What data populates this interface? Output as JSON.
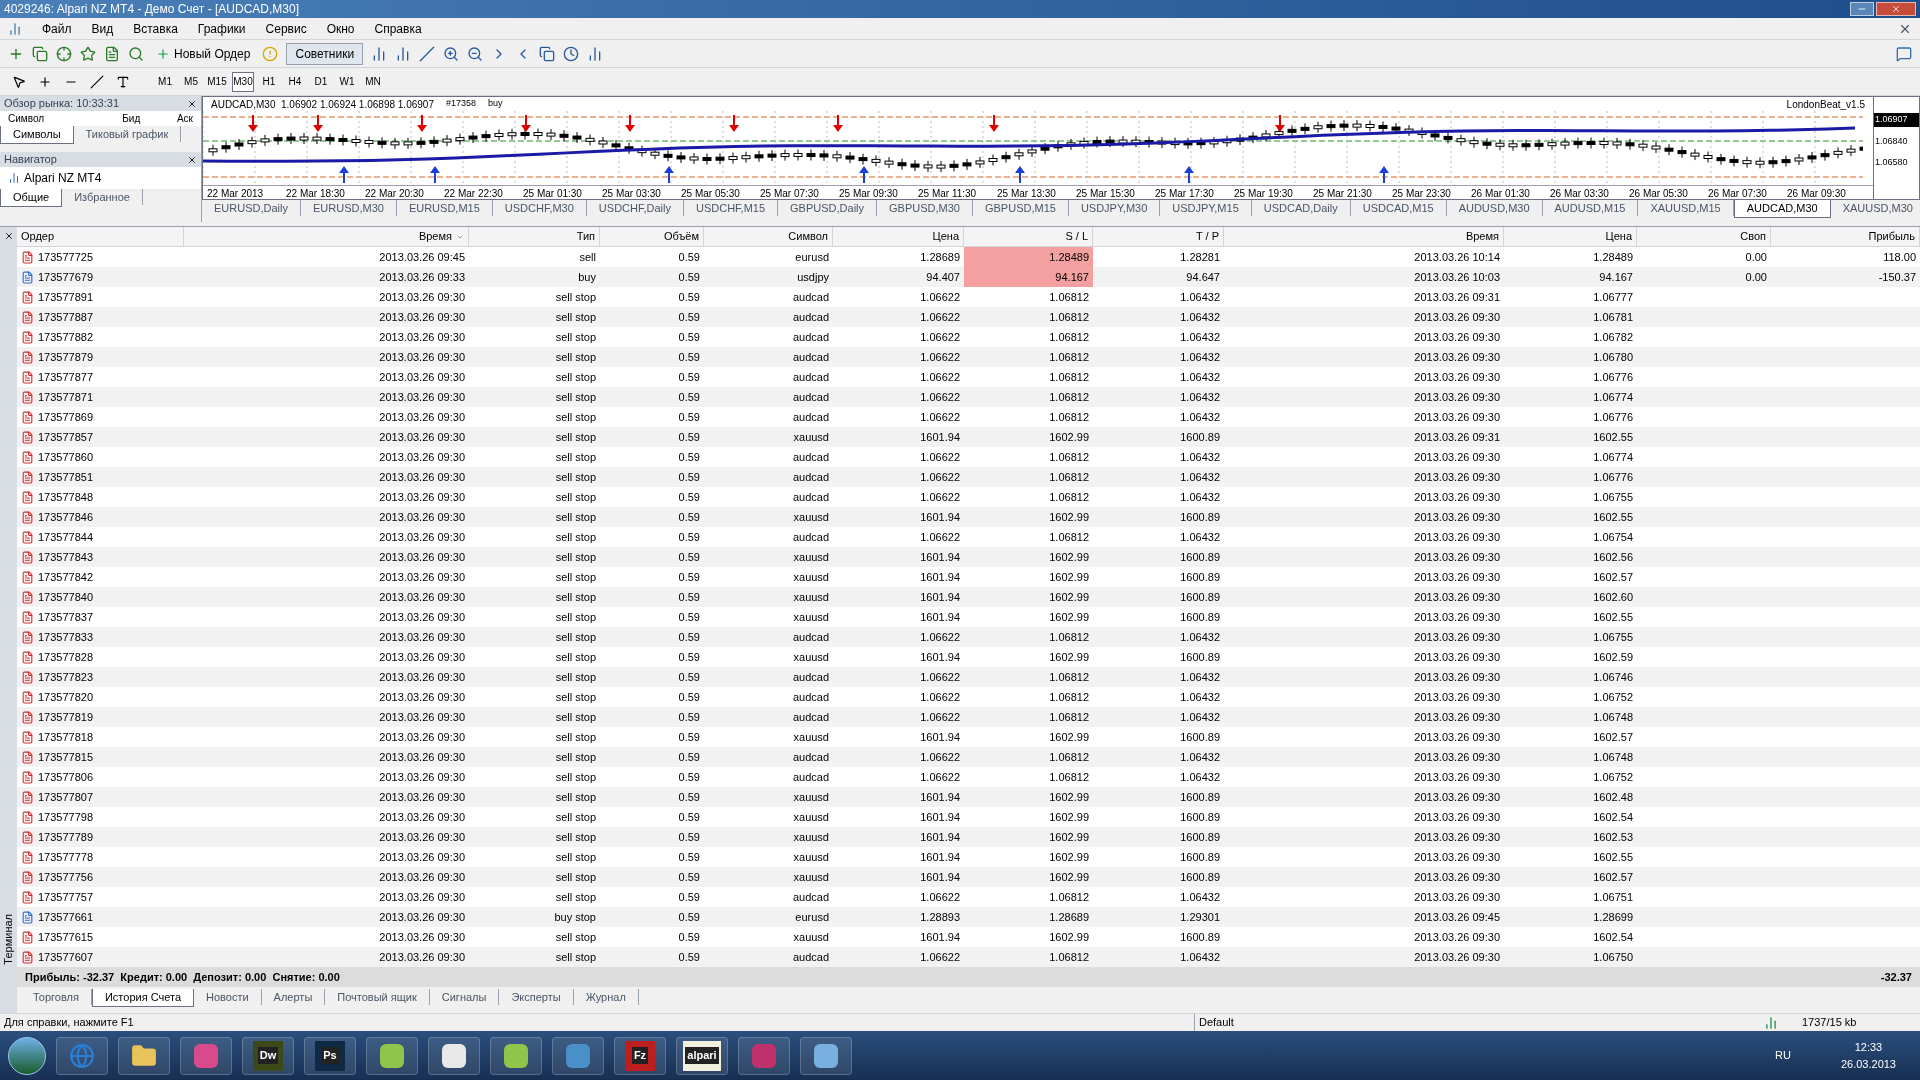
{
  "window": {
    "title": "4029246: Alpari NZ MT4 - Демо Счет - [AUDCAD,M30]"
  },
  "menu": [
    "Файл",
    "Вид",
    "Вставка",
    "Графики",
    "Сервис",
    "Окно",
    "Справка"
  ],
  "toolbar": {
    "buttons": [
      {
        "label": "Новый Ордер"
      },
      {
        "label": "Советники"
      }
    ],
    "timeframes": [
      {
        "label": "M1",
        "selected": false
      },
      {
        "label": "M5",
        "selected": false
      },
      {
        "label": "M15",
        "selected": false
      },
      {
        "label": "M30",
        "selected": true
      },
      {
        "label": "H1",
        "selected": false
      },
      {
        "label": "H4",
        "selected": false
      },
      {
        "label": "D1",
        "selected": false
      },
      {
        "label": "W1",
        "selected": false
      },
      {
        "label": "MN",
        "selected": false
      }
    ]
  },
  "market_watch": {
    "title": "Обзор рынка: 10:33:31",
    "columns": [
      "Символ",
      "Бид",
      "Аск"
    ],
    "tabs": [
      {
        "label": "Символы",
        "selected": true
      },
      {
        "label": "Тиковый график",
        "selected": false
      }
    ]
  },
  "navigator": {
    "title": "Навигатор",
    "tree": [
      {
        "label": "Alpari NZ MT4"
      }
    ],
    "tabs": [
      {
        "label": "Общие",
        "selected": true
      },
      {
        "label": "Избранное",
        "selected": false
      }
    ]
  },
  "chart": {
    "header": "AUDCAD,M30  1.06902 1.06924 1.06898 1.06907",
    "order_label": "#17358",
    "order_type": "buy",
    "indicator": "LondonBeat_v1.5",
    "price_labels": [
      {
        "text": "1.06907",
        "kind": "current"
      },
      {
        "text": "1.06840",
        "kind": "level"
      },
      {
        "text": "1.06580",
        "kind": "level"
      }
    ],
    "time_labels": [
      "22 Mar 2013",
      "22 Mar 18:30",
      "22 Mar 20:30",
      "22 Mar 22:30",
      "25 Mar 01:30",
      "25 Mar 03:30",
      "25 Mar 05:30",
      "25 Mar 07:30",
      "25 Mar 09:30",
      "25 Mar 11:30",
      "25 Mar 13:30",
      "25 Mar 15:30",
      "25 Mar 17:30",
      "25 Mar 19:30",
      "25 Mar 21:30",
      "25 Mar 23:30",
      "26 Mar 01:30",
      "26 Mar 03:30",
      "26 Mar 05:30",
      "26 Mar 07:30",
      "26 Mar 09:30"
    ]
  },
  "chart_tabs": [
    {
      "label": "EURUSD,Daily",
      "selected": false
    },
    {
      "label": "EURUSD,M30",
      "selected": false
    },
    {
      "label": "EURUSD,M15",
      "selected": false
    },
    {
      "label": "USDCHF,M30",
      "selected": false
    },
    {
      "label": "USDCHF,Daily",
      "selected": false
    },
    {
      "label": "USDCHF,M15",
      "selected": false
    },
    {
      "label": "GBPUSD,Daily",
      "selected": false
    },
    {
      "label": "GBPUSD,M30",
      "selected": false
    },
    {
      "label": "GBPUSD,M15",
      "selected": false
    },
    {
      "label": "USDJPY,M30",
      "selected": false
    },
    {
      "label": "USDJPY,M15",
      "selected": false
    },
    {
      "label": "USDCAD,Daily",
      "selected": false
    },
    {
      "label": "USDCAD,M15",
      "selected": false
    },
    {
      "label": "AUDUSD,M30",
      "selected": false
    },
    {
      "label": "AUDUSD,M15",
      "selected": false
    },
    {
      "label": "XAUUSD,M15",
      "selected": false
    },
    {
      "label": "AUDCAD,M30",
      "selected": true
    },
    {
      "label": "XAUUSD,M30",
      "selected": false
    }
  ],
  "terminal": {
    "title": "Терминал",
    "columns": [
      "Ордер",
      "Время",
      "Тип",
      "Объём",
      "Символ",
      "Цена",
      "S / L",
      "T / P",
      "Время",
      "Цена",
      "Своп",
      "Прибыль"
    ],
    "rows": [
      {
        "kind": "sell",
        "sl_highlighted": true,
        "cells": [
          "173577725",
          "2013.03.26 09:45",
          "sell",
          "0.59",
          "eurusd",
          "1.28689",
          "1.28489",
          "1.28281",
          "2013.03.26 10:14",
          "1.28489",
          "0.00",
          "118.00"
        ]
      },
      {
        "kind": "buy",
        "sl_highlighted": true,
        "cells": [
          "173577679",
          "2013.03.26 09:33",
          "buy",
          "0.59",
          "usdjpy",
          "94.407",
          "94.167",
          "94.647",
          "2013.03.26 10:03",
          "94.167",
          "0.00",
          "-150.37"
        ]
      },
      {
        "kind": "sell",
        "sl_highlighted": false,
        "cells": [
          "173577891",
          "2013.03.26 09:30",
          "sell stop",
          "0.59",
          "audcad",
          "1.06622",
          "1.06812",
          "1.06432",
          "2013.03.26 09:31",
          "1.06777"
        ]
      },
      {
        "kind": "sell",
        "sl_highlighted": false,
        "cells": [
          "173577887",
          "2013.03.26 09:30",
          "sell stop",
          "0.59",
          "audcad",
          "1.06622",
          "1.06812",
          "1.06432",
          "2013.03.26 09:30",
          "1.06781"
        ]
      },
      {
        "kind": "sell",
        "sl_highlighted": false,
        "cells": [
          "173577882",
          "2013.03.26 09:30",
          "sell stop",
          "0.59",
          "audcad",
          "1.06622",
          "1.06812",
          "1.06432",
          "2013.03.26 09:30",
          "1.06782"
        ]
      },
      {
        "kind": "sell",
        "sl_highlighted": false,
        "cells": [
          "173577879",
          "2013.03.26 09:30",
          "sell stop",
          "0.59",
          "audcad",
          "1.06622",
          "1.06812",
          "1.06432",
          "2013.03.26 09:30",
          "1.06780"
        ]
      },
      {
        "kind": "sell",
        "sl_highlighted": false,
        "cells": [
          "173577877",
          "2013.03.26 09:30",
          "sell stop",
          "0.59",
          "audcad",
          "1.06622",
          "1.06812",
          "1.06432",
          "2013.03.26 09:30",
          "1.06776"
        ]
      },
      {
        "kind": "sell",
        "sl_highlighted": false,
        "cells": [
          "173577871",
          "2013.03.26 09:30",
          "sell stop",
          "0.59",
          "audcad",
          "1.06622",
          "1.06812",
          "1.06432",
          "2013.03.26 09:30",
          "1.06774"
        ]
      },
      {
        "kind": "sell",
        "sl_highlighted": false,
        "cells": [
          "173577869",
          "2013.03.26 09:30",
          "sell stop",
          "0.59",
          "audcad",
          "1.06622",
          "1.06812",
          "1.06432",
          "2013.03.26 09:30",
          "1.06776"
        ]
      },
      {
        "kind": "sell",
        "sl_highlighted": false,
        "cells": [
          "173577857",
          "2013.03.26 09:30",
          "sell stop",
          "0.59",
          "xauusd",
          "1601.94",
          "1602.99",
          "1600.89",
          "2013.03.26 09:31",
          "1602.55"
        ]
      },
      {
        "kind": "sell",
        "sl_highlighted": false,
        "cells": [
          "173577860",
          "2013.03.26 09:30",
          "sell stop",
          "0.59",
          "audcad",
          "1.06622",
          "1.06812",
          "1.06432",
          "2013.03.26 09:30",
          "1.06774"
        ]
      },
      {
        "kind": "sell",
        "sl_highlighted": false,
        "cells": [
          "173577851",
          "2013.03.26 09:30",
          "sell stop",
          "0.59",
          "audcad",
          "1.06622",
          "1.06812",
          "1.06432",
          "2013.03.26 09:30",
          "1.06776"
        ]
      },
      {
        "kind": "sell",
        "sl_highlighted": false,
        "cells": [
          "173577848",
          "2013.03.26 09:30",
          "sell stop",
          "0.59",
          "audcad",
          "1.06622",
          "1.06812",
          "1.06432",
          "2013.03.26 09:30",
          "1.06755"
        ]
      },
      {
        "kind": "sell",
        "sl_highlighted": false,
        "cells": [
          "173577846",
          "2013.03.26 09:30",
          "sell stop",
          "0.59",
          "xauusd",
          "1601.94",
          "1602.99",
          "1600.89",
          "2013.03.26 09:30",
          "1602.55"
        ]
      },
      {
        "kind": "sell",
        "sl_highlighted": false,
        "cells": [
          "173577844",
          "2013.03.26 09:30",
          "sell stop",
          "0.59",
          "audcad",
          "1.06622",
          "1.06812",
          "1.06432",
          "2013.03.26 09:30",
          "1.06754"
        ]
      },
      {
        "kind": "sell",
        "sl_highlighted": false,
        "cells": [
          "173577843",
          "2013.03.26 09:30",
          "sell stop",
          "0.59",
          "xauusd",
          "1601.94",
          "1602.99",
          "1600.89",
          "2013.03.26 09:30",
          "1602.56"
        ]
      },
      {
        "kind": "sell",
        "sl_highlighted": false,
        "cells": [
          "173577842",
          "2013.03.26 09:30",
          "sell stop",
          "0.59",
          "xauusd",
          "1601.94",
          "1602.99",
          "1600.89",
          "2013.03.26 09:30",
          "1602.57"
        ]
      },
      {
        "kind": "sell",
        "sl_highlighted": false,
        "cells": [
          "173577840",
          "2013.03.26 09:30",
          "sell stop",
          "0.59",
          "xauusd",
          "1601.94",
          "1602.99",
          "1600.89",
          "2013.03.26 09:30",
          "1602.60"
        ]
      },
      {
        "kind": "sell",
        "sl_highlighted": false,
        "cells": [
          "173577837",
          "2013.03.26 09:30",
          "sell stop",
          "0.59",
          "xauusd",
          "1601.94",
          "1602.99",
          "1600.89",
          "2013.03.26 09:30",
          "1602.55"
        ]
      },
      {
        "kind": "sell",
        "sl_highlighted": false,
        "cells": [
          "173577833",
          "2013.03.26 09:30",
          "sell stop",
          "0.59",
          "audcad",
          "1.06622",
          "1.06812",
          "1.06432",
          "2013.03.26 09:30",
          "1.06755"
        ]
      },
      {
        "kind": "sell",
        "sl_highlighted": false,
        "cells": [
          "173577828",
          "2013.03.26 09:30",
          "sell stop",
          "0.59",
          "xauusd",
          "1601.94",
          "1602.99",
          "1600.89",
          "2013.03.26 09:30",
          "1602.59"
        ]
      },
      {
        "kind": "sell",
        "sl_highlighted": false,
        "cells": [
          "173577823",
          "2013.03.26 09:30",
          "sell stop",
          "0.59",
          "audcad",
          "1.06622",
          "1.06812",
          "1.06432",
          "2013.03.26 09:30",
          "1.06746"
        ]
      },
      {
        "kind": "sell",
        "sl_highlighted": false,
        "cells": [
          "173577820",
          "2013.03.26 09:30",
          "sell stop",
          "0.59",
          "audcad",
          "1.06622",
          "1.06812",
          "1.06432",
          "2013.03.26 09:30",
          "1.06752"
        ]
      },
      {
        "kind": "sell",
        "sl_highlighted": false,
        "cells": [
          "173577819",
          "2013.03.26 09:30",
          "sell stop",
          "0.59",
          "audcad",
          "1.06622",
          "1.06812",
          "1.06432",
          "2013.03.26 09:30",
          "1.06748"
        ]
      },
      {
        "kind": "sell",
        "sl_highlighted": false,
        "cells": [
          "173577818",
          "2013.03.26 09:30",
          "sell stop",
          "0.59",
          "xauusd",
          "1601.94",
          "1602.99",
          "1600.89",
          "2013.03.26 09:30",
          "1602.57"
        ]
      },
      {
        "kind": "sell",
        "sl_highlighted": false,
        "cells": [
          "173577815",
          "2013.03.26 09:30",
          "sell stop",
          "0.59",
          "audcad",
          "1.06622",
          "1.06812",
          "1.06432",
          "2013.03.26 09:30",
          "1.06748"
        ]
      },
      {
        "kind": "sell",
        "sl_highlighted": false,
        "cells": [
          "173577806",
          "2013.03.26 09:30",
          "sell stop",
          "0.59",
          "audcad",
          "1.06622",
          "1.06812",
          "1.06432",
          "2013.03.26 09:30",
          "1.06752"
        ]
      },
      {
        "kind": "sell",
        "sl_highlighted": false,
        "cells": [
          "173577807",
          "2013.03.26 09:30",
          "sell stop",
          "0.59",
          "xauusd",
          "1601.94",
          "1602.99",
          "1600.89",
          "2013.03.26 09:30",
          "1602.48"
        ]
      },
      {
        "kind": "sell",
        "sl_highlighted": false,
        "cells": [
          "173577798",
          "2013.03.26 09:30",
          "sell stop",
          "0.59",
          "xauusd",
          "1601.94",
          "1602.99",
          "1600.89",
          "2013.03.26 09:30",
          "1602.54"
        ]
      },
      {
        "kind": "sell",
        "sl_highlighted": false,
        "cells": [
          "173577789",
          "2013.03.26 09:30",
          "sell stop",
          "0.59",
          "xauusd",
          "1601.94",
          "1602.99",
          "1600.89",
          "2013.03.26 09:30",
          "1602.53"
        ]
      },
      {
        "kind": "sell",
        "sl_highlighted": false,
        "cells": [
          "173577778",
          "2013.03.26 09:30",
          "sell stop",
          "0.59",
          "xauusd",
          "1601.94",
          "1602.99",
          "1600.89",
          "2013.03.26 09:30",
          "1602.55"
        ]
      },
      {
        "kind": "sell",
        "sl_highlighted": false,
        "cells": [
          "173577756",
          "2013.03.26 09:30",
          "sell stop",
          "0.59",
          "xauusd",
          "1601.94",
          "1602.99",
          "1600.89",
          "2013.03.26 09:30",
          "1602.57"
        ]
      },
      {
        "kind": "sell",
        "sl_highlighted": false,
        "cells": [
          "173577757",
          "2013.03.26 09:30",
          "sell stop",
          "0.59",
          "audcad",
          "1.06622",
          "1.06812",
          "1.06432",
          "2013.03.26 09:30",
          "1.06751"
        ]
      },
      {
        "kind": "buy",
        "sl_highlighted": false,
        "cells": [
          "173577661",
          "2013.03.26 09:30",
          "buy stop",
          "0.59",
          "eurusd",
          "1.28893",
          "1.28689",
          "1.29301",
          "2013.03.26 09:45",
          "1.28699"
        ]
      },
      {
        "kind": "sell",
        "sl_highlighted": false,
        "cells": [
          "173577615",
          "2013.03.26 09:30",
          "sell stop",
          "0.59",
          "xauusd",
          "1601.94",
          "1602.99",
          "1600.89",
          "2013.03.26 09:30",
          "1602.54"
        ]
      },
      {
        "kind": "sell",
        "sl_highlighted": false,
        "cells": [
          "173577607",
          "2013.03.26 09:30",
          "sell stop",
          "0.59",
          "audcad",
          "1.06622",
          "1.06812",
          "1.06432",
          "2013.03.26 09:30",
          "1.06750"
        ]
      }
    ],
    "summary": "Прибыль: -32.37  Кредит: 0.00  Депозит: 0.00  Снятие: 0.00",
    "total": "-32.37",
    "tabs": [
      {
        "label": "Торговля",
        "selected": false
      },
      {
        "label": "История Счета",
        "selected": true
      },
      {
        "label": "Новости",
        "selected": false
      },
      {
        "label": "Алерты",
        "selected": false
      },
      {
        "label": "Почтовый ящик",
        "selected": false
      },
      {
        "label": "Сигналы",
        "selected": false
      },
      {
        "label": "Эксперты",
        "selected": false
      },
      {
        "label": "Журнал",
        "selected": false
      }
    ]
  },
  "status_bar": {
    "help": "Для справки, нажмите F1",
    "profile": "Default",
    "traffic": "1737/15 kb"
  },
  "taskbar": {
    "items": [
      {
        "kind": "globe",
        "color": "#2a7fd4"
      },
      {
        "kind": "folder",
        "color": "#e8c25a"
      },
      {
        "kind": "shape",
        "color": "#d94a8c"
      },
      {
        "kind": "tile",
        "label": "Dw",
        "color": "#3c4a1a"
      },
      {
        "kind": "tile",
        "label": "Ps",
        "color": "#0e2a44"
      },
      {
        "kind": "shape",
        "color": "#8fc54a"
      },
      {
        "kind": "shape",
        "color": "#e8e8e8"
      },
      {
        "kind": "shape",
        "color": "#8fc54a"
      },
      {
        "kind": "shape",
        "color": "#4a90c8"
      },
      {
        "kind": "tile",
        "label": "Fz",
        "color": "#bf1e1e"
      },
      {
        "kind": "tile",
        "label": "alpari",
        "color": "#f4f0e0"
      },
      {
        "kind": "shape",
        "color": "#c0306a"
      },
      {
        "kind": "shape",
        "color": "#7ab0e0"
      }
    ],
    "language": "RU",
    "time": "12:33",
    "date": "26.03.2013"
  }
}
